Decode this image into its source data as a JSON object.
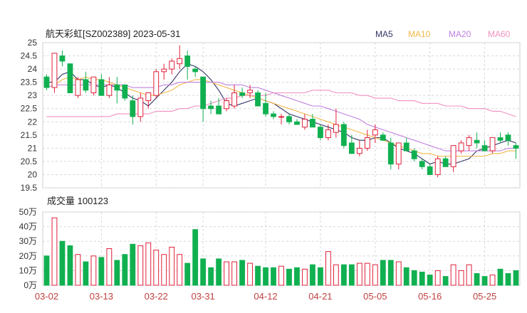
{
  "chart_data": [
    {
      "type": "candlestick",
      "title": "航天彩虹[SZ002389] 2023-05-31",
      "ylim": [
        19.5,
        25
      ],
      "y_ticks": [
        "25",
        "24.5",
        "24",
        "23.5",
        "23",
        "22.5",
        "22",
        "21.5",
        "21",
        "20.5",
        "20",
        "19.5"
      ],
      "grid": true,
      "legend": [
        {
          "name": "MA5",
          "color": "#333366"
        },
        {
          "name": "MA10",
          "color": "#f0b848"
        },
        {
          "name": "MA20",
          "color": "#c080e0"
        },
        {
          "name": "MA60",
          "color": "#f090c0"
        }
      ],
      "up_color": "#e0203a",
      "down_color": "#10b050",
      "x": [
        "03-02",
        "03-03",
        "03-06",
        "03-07",
        "03-08",
        "03-09",
        "03-10",
        "03-13",
        "03-14",
        "03-15",
        "03-16",
        "03-17",
        "03-20",
        "03-21",
        "03-22",
        "03-23",
        "03-24",
        "03-27",
        "03-28",
        "03-29",
        "03-30",
        "03-31",
        "04-03",
        "04-04",
        "04-06",
        "04-07",
        "04-10",
        "04-11",
        "04-12",
        "04-13",
        "04-14",
        "04-17",
        "04-18",
        "04-19",
        "04-20",
        "04-21",
        "04-24",
        "04-25",
        "04-26",
        "04-27",
        "04-28",
        "05-04",
        "05-05",
        "05-08",
        "05-09",
        "05-10",
        "05-11",
        "05-12",
        "05-15",
        "05-16",
        "05-17",
        "05-18",
        "05-19",
        "05-22",
        "05-23",
        "05-24",
        "05-25",
        "05-26",
        "05-29",
        "05-30",
        "05-31"
      ],
      "x_tick_labels": [
        "03-02",
        "03-13",
        "03-22",
        "03-31",
        "04-12",
        "04-21",
        "05-05",
        "05-16",
        "05-25"
      ],
      "x_tick_index": [
        0,
        7,
        14,
        20,
        28,
        35,
        42,
        49,
        56
      ],
      "ohlc": [
        [
          23.7,
          23.8,
          23.2,
          23.3
        ],
        [
          23.3,
          24.4,
          23.1,
          24.6
        ],
        [
          24.5,
          24.7,
          24.1,
          24.3
        ],
        [
          24.2,
          24.2,
          23.1,
          23.1
        ],
        [
          23.0,
          23.7,
          22.9,
          23.6
        ],
        [
          23.6,
          23.9,
          23.1,
          23.2
        ],
        [
          23.1,
          23.7,
          23.0,
          23.7
        ],
        [
          23.6,
          23.8,
          23.0,
          23.0
        ],
        [
          23.0,
          23.7,
          22.9,
          23.4
        ],
        [
          23.4,
          23.7,
          22.7,
          23.2
        ],
        [
          23.4,
          23.4,
          22.8,
          22.9
        ],
        [
          22.8,
          23.0,
          21.9,
          22.2
        ],
        [
          22.2,
          23.1,
          22.0,
          22.9
        ],
        [
          22.8,
          23.0,
          22.5,
          23.1
        ],
        [
          23.0,
          24.0,
          22.9,
          23.9
        ],
        [
          23.9,
          24.2,
          23.6,
          24.0
        ],
        [
          24.0,
          24.4,
          23.8,
          24.3
        ],
        [
          24.2,
          24.9,
          24.0,
          24.4
        ],
        [
          24.5,
          24.7,
          23.6,
          24.1
        ],
        [
          24.0,
          24.1,
          23.7,
          23.9
        ],
        [
          23.7,
          23.7,
          22.0,
          22.5
        ],
        [
          22.6,
          22.8,
          22.3,
          22.5
        ],
        [
          22.6,
          22.9,
          22.3,
          22.3
        ],
        [
          22.5,
          22.9,
          22.4,
          22.8
        ],
        [
          22.6,
          23.4,
          22.5,
          23.1
        ],
        [
          23.1,
          23.3,
          22.9,
          23.0
        ],
        [
          23.1,
          23.4,
          22.9,
          23.2
        ],
        [
          23.1,
          23.2,
          22.6,
          22.6
        ],
        [
          22.7,
          23.1,
          22.2,
          22.3
        ],
        [
          22.3,
          22.4,
          22.1,
          22.2
        ],
        [
          22.2,
          22.3,
          21.9,
          22.2
        ],
        [
          22.2,
          22.3,
          21.9,
          22.0
        ],
        [
          22.0,
          22.1,
          21.9,
          21.9
        ],
        [
          21.8,
          22.3,
          21.7,
          22.1
        ],
        [
          22.1,
          22.3,
          21.8,
          21.8
        ],
        [
          21.8,
          21.9,
          21.3,
          21.4
        ],
        [
          21.4,
          21.9,
          21.3,
          21.7
        ],
        [
          21.6,
          22.5,
          21.4,
          21.9
        ],
        [
          21.9,
          22.0,
          21.0,
          21.1
        ],
        [
          21.2,
          21.5,
          20.8,
          20.8
        ],
        [
          20.8,
          21.3,
          20.7,
          21.0
        ],
        [
          21.0,
          21.7,
          20.9,
          21.4
        ],
        [
          21.5,
          21.9,
          21.2,
          21.7
        ],
        [
          21.5,
          21.6,
          21.3,
          21.3
        ],
        [
          21.2,
          21.4,
          20.2,
          20.4
        ],
        [
          20.4,
          21.2,
          20.2,
          21.2
        ],
        [
          21.2,
          21.4,
          20.9,
          20.9
        ],
        [
          20.9,
          21.0,
          20.5,
          20.6
        ],
        [
          20.5,
          20.6,
          20.2,
          20.3
        ],
        [
          20.3,
          20.4,
          20.0,
          20.0
        ],
        [
          20.0,
          20.7,
          19.9,
          20.6
        ],
        [
          20.6,
          20.7,
          20.4,
          20.3
        ],
        [
          20.3,
          21.1,
          20.1,
          21.1
        ],
        [
          20.9,
          21.3,
          20.8,
          21.2
        ],
        [
          21.1,
          21.5,
          20.9,
          21.4
        ],
        [
          21.3,
          21.6,
          21.0,
          21.2
        ],
        [
          21.1,
          21.3,
          20.9,
          20.9
        ],
        [
          20.9,
          21.4,
          20.8,
          21.4
        ],
        [
          21.4,
          21.6,
          21.2,
          21.3
        ],
        [
          21.5,
          21.6,
          21.1,
          21.3
        ],
        [
          21.1,
          21.2,
          20.6,
          21.0
        ]
      ],
      "series": [
        {
          "name": "MA5",
          "color": "#333366",
          "values": [
            23.5,
            23.5,
            23.8,
            23.9,
            23.6,
            23.6,
            23.4,
            23.3,
            23.4,
            23.3,
            23.1,
            22.9,
            22.8,
            22.6,
            22.9,
            23.2,
            23.5,
            23.9,
            24.2,
            24.1,
            23.9,
            23.6,
            23.2,
            22.7,
            22.6,
            22.7,
            22.8,
            22.9,
            22.8,
            22.7,
            22.5,
            22.3,
            22.2,
            22.1,
            22.0,
            21.9,
            21.8,
            21.7,
            21.6,
            21.4,
            21.3,
            21.3,
            21.4,
            21.4,
            21.2,
            21.0,
            20.9,
            20.8,
            20.6,
            20.4,
            20.5,
            20.4,
            20.4,
            20.5,
            20.6,
            20.9,
            21.0,
            21.1,
            21.2,
            21.3,
            21.2
          ]
        },
        {
          "name": "MA10",
          "color": "#f0b848",
          "values": [
            23.3,
            23.4,
            23.6,
            23.7,
            23.6,
            23.7,
            23.6,
            23.6,
            23.5,
            23.4,
            23.3,
            23.2,
            23.1,
            23.0,
            23.0,
            23.1,
            23.2,
            23.4,
            23.5,
            23.6,
            23.6,
            23.5,
            23.4,
            23.3,
            23.2,
            23.1,
            23.0,
            22.9,
            22.8,
            22.7,
            22.6,
            22.5,
            22.4,
            22.3,
            22.2,
            22.1,
            22.0,
            21.9,
            21.8,
            21.7,
            21.6,
            21.5,
            21.4,
            21.3,
            21.2,
            21.1,
            21.0,
            20.9,
            20.8,
            20.8,
            20.7,
            20.7,
            20.7,
            20.7,
            20.7,
            20.7,
            20.7,
            20.8,
            20.8,
            20.9,
            20.9
          ]
        },
        {
          "name": "MA20",
          "color": "#c080e0",
          "values": [
            23.3,
            23.4,
            23.4,
            23.4,
            23.4,
            23.4,
            23.4,
            23.4,
            23.4,
            23.4,
            23.4,
            23.3,
            23.3,
            23.3,
            23.3,
            23.4,
            23.4,
            23.5,
            23.5,
            23.5,
            23.5,
            23.5,
            23.5,
            23.4,
            23.4,
            23.4,
            23.3,
            23.3,
            23.2,
            23.1,
            23.0,
            22.9,
            22.8,
            22.7,
            22.6,
            22.6,
            22.5,
            22.4,
            22.3,
            22.2,
            22.1,
            21.9,
            21.8,
            21.7,
            21.6,
            21.5,
            21.4,
            21.3,
            21.2,
            21.1,
            21.0,
            20.9,
            20.9,
            20.9,
            20.9,
            20.9,
            20.9,
            20.9,
            20.9,
            21.0,
            21.0
          ]
        },
        {
          "name": "MA60",
          "color": "#f090c0",
          "values": [
            22.2,
            22.2,
            22.2,
            22.2,
            22.2,
            22.2,
            22.2,
            22.2,
            22.2,
            22.3,
            22.3,
            22.3,
            22.3,
            22.3,
            22.4,
            22.4,
            22.4,
            22.5,
            22.5,
            22.6,
            22.6,
            22.7,
            22.8,
            22.9,
            22.9,
            23.0,
            23.0,
            23.0,
            23.0,
            23.1,
            23.1,
            23.1,
            23.1,
            23.1,
            23.2,
            23.2,
            23.2,
            23.1,
            23.1,
            23.1,
            23.0,
            23.0,
            22.9,
            22.9,
            22.9,
            22.8,
            22.8,
            22.8,
            22.7,
            22.7,
            22.7,
            22.6,
            22.6,
            22.6,
            22.5,
            22.5,
            22.5,
            22.4,
            22.4,
            22.3,
            22.2
          ]
        }
      ]
    },
    {
      "type": "bar",
      "title": "成交量 100123",
      "ylim": [
        0,
        50
      ],
      "y_ticks": [
        "50万",
        "40万",
        "30万",
        "20万",
        "10万",
        "0万"
      ],
      "grid": true,
      "values": [
        20,
        46,
        30,
        27,
        21,
        16,
        20,
        19,
        25,
        17,
        21,
        28,
        27,
        29,
        24,
        21,
        26,
        21,
        15,
        38,
        18,
        12,
        18,
        16,
        16,
        17,
        15,
        13,
        12,
        12,
        13,
        11,
        12,
        11,
        14,
        12,
        23,
        14,
        14,
        14,
        15,
        15,
        14,
        17,
        17,
        16,
        12,
        10,
        9,
        7,
        10,
        6,
        14,
        10,
        14,
        8,
        6,
        7,
        11,
        8,
        10
      ]
    }
  ]
}
